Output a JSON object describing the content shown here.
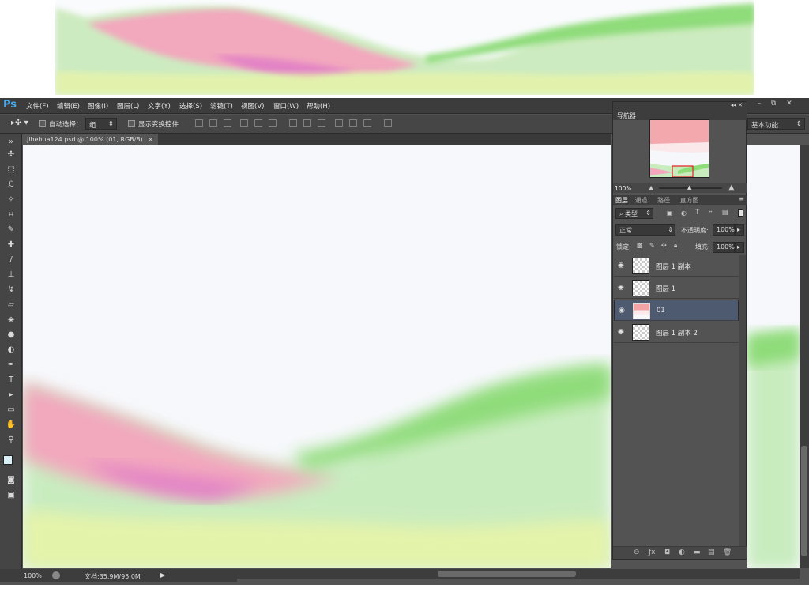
{
  "app": {
    "logo": "Ps"
  },
  "menu": [
    "文件(F)",
    "编辑(E)",
    "图像(I)",
    "图层(L)",
    "文字(Y)",
    "选择(S)",
    "滤镜(T)",
    "视图(V)",
    "窗口(W)",
    "帮助(H)"
  ],
  "window_controls": {
    "minimize": "–",
    "restore": "⧉",
    "close": "✕"
  },
  "options": {
    "auto_select_label": "自动选择：",
    "auto_select_value": "组",
    "show_transform_label": "显示变换控件",
    "workspace": "基本功能"
  },
  "document": {
    "tab": "jihehua124.psd @ 100% (01, RGB/8)"
  },
  "status": {
    "zoom": "100%",
    "doc": "文档:35.9M/95.0M"
  },
  "navigator": {
    "title": "导航器",
    "zoom": "100%"
  },
  "layers_panel": {
    "tabs": [
      "图层",
      "通道",
      "路径",
      "直方图"
    ],
    "filter": "类型",
    "blend_mode": "正常",
    "opacity_label": "不透明度:",
    "opacity_value": "100%",
    "lock_label": "锁定:",
    "fill_label": "填充:",
    "fill_value": "100%",
    "layers": [
      {
        "name": "图层 1 副本",
        "selected": false,
        "thumb": "transparent"
      },
      {
        "name": "图层 1",
        "selected": false,
        "thumb": "transparent"
      },
      {
        "name": "01",
        "selected": true,
        "thumb": "landscape"
      },
      {
        "name": "图层 1 副本 2",
        "selected": false,
        "thumb": "transparent"
      }
    ]
  },
  "colors": {
    "accent": "#4aa8e8",
    "selected_layer": "#4d5a70",
    "pink": "#f0a0b8",
    "magenta": "#e070c0",
    "green": "#8fdc7a",
    "yellow": "#e8f0a0"
  }
}
